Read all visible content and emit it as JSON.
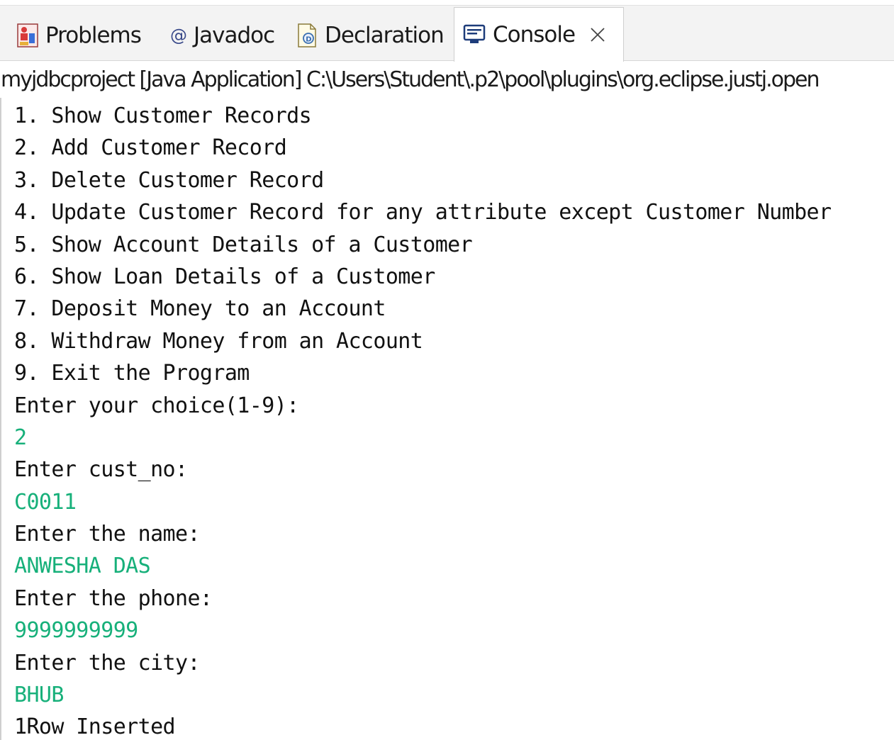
{
  "tabs": [
    {
      "label": "Problems",
      "icon": "problems-icon"
    },
    {
      "label": "Javadoc",
      "icon": "at-sign-icon"
    },
    {
      "label": "Declaration",
      "icon": "declaration-icon"
    },
    {
      "label": "Console",
      "icon": "console-icon",
      "active": true
    }
  ],
  "console": {
    "description": "myjdbcproject [Java Application] C:\\Users\\Student\\.p2\\pool\\plugins\\org.eclipse.justj.open",
    "lines": [
      {
        "text": "1. Show Customer Records",
        "kind": "out"
      },
      {
        "text": "2. Add Customer Record",
        "kind": "out"
      },
      {
        "text": "3. Delete Customer Record",
        "kind": "out"
      },
      {
        "text": "4. Update Customer Record for any attribute except Customer Number",
        "kind": "out"
      },
      {
        "text": "5. Show Account Details of a Customer",
        "kind": "out"
      },
      {
        "text": "6. Show Loan Details of a Customer",
        "kind": "out"
      },
      {
        "text": "7. Deposit Money to an Account",
        "kind": "out"
      },
      {
        "text": "8. Withdraw Money from an Account",
        "kind": "out"
      },
      {
        "text": "9. Exit the Program",
        "kind": "out"
      },
      {
        "text": "Enter your choice(1-9):",
        "kind": "out"
      },
      {
        "text": "2",
        "kind": "in"
      },
      {
        "text": "Enter cust_no:",
        "kind": "out"
      },
      {
        "text": "C0011",
        "kind": "in"
      },
      {
        "text": "Enter the name:",
        "kind": "out"
      },
      {
        "text": "ANWESHA DAS",
        "kind": "in"
      },
      {
        "text": "Enter the phone:",
        "kind": "out"
      },
      {
        "text": "9999999999",
        "kind": "in"
      },
      {
        "text": "Enter the city:",
        "kind": "out"
      },
      {
        "text": "BHUB",
        "kind": "in"
      },
      {
        "text": "1Row Inserted",
        "kind": "out"
      }
    ]
  },
  "colors": {
    "input_text": "#17b07a",
    "output_text": "#111111",
    "tab_bar": "#f3f3f3"
  }
}
